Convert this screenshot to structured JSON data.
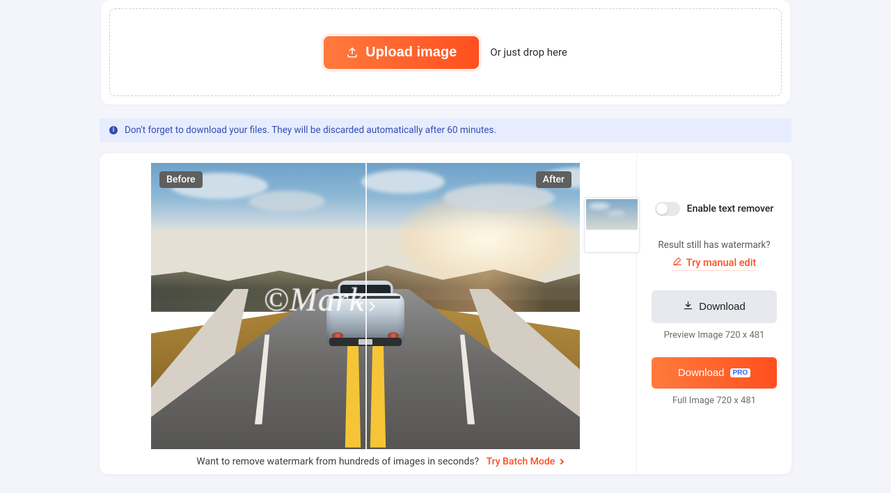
{
  "upload": {
    "button_label": "Upload image",
    "drop_hint": "Or just drop here"
  },
  "notice": {
    "text": "Don't forget to download your files. They will be discarded automatically after 60 minutes."
  },
  "compare": {
    "before_label": "Before",
    "after_label": "After",
    "watermark_text": "©Mark"
  },
  "batch_prompt": {
    "question": "Want to remove watermark from hundreds of images in seconds?",
    "link": "Try Batch Mode"
  },
  "side": {
    "text_remover_label": "Enable text remover",
    "still_has_wm": "Result still has watermark?",
    "try_manual": "Try manual edit",
    "download_label": "Download",
    "preview_caption": "Preview Image 720 x 481",
    "download_pro_label": "Download",
    "pro_badge": "PRO",
    "full_caption": "Full Image 720 x 481"
  }
}
